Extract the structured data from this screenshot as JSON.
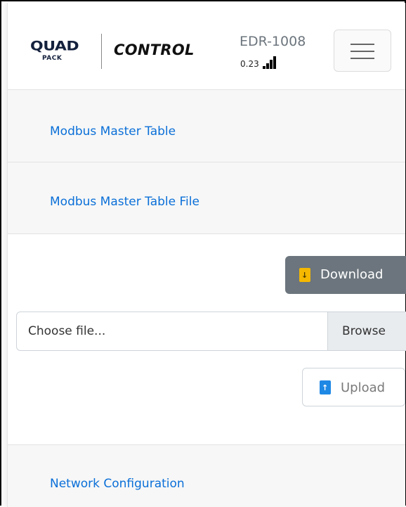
{
  "header": {
    "logo_quad": "QUAD",
    "logo_pack": "PACK",
    "logo_control": "CONTROL",
    "device_name": "EDR-1008",
    "device_version": "0.23",
    "signal_icon": "signal-strength-icon",
    "menu_icon": "hamburger-menu-icon"
  },
  "sections": {
    "modbus_master_table": "Modbus Master Table",
    "modbus_master_table_file": "Modbus Master Table File",
    "network_configuration": "Network Configuration"
  },
  "file_panel": {
    "download_label": "Download",
    "download_icon": "file-download-icon",
    "file_placeholder": "Choose file...",
    "browse_label": "Browse",
    "upload_label": "Upload",
    "upload_icon": "file-upload-icon"
  },
  "colors": {
    "link": "#0a6fd8",
    "download_bg": "#6c757d",
    "download_icon": "#f5b800",
    "upload_icon": "#1e88e5",
    "section_bg": "#f7f7f7"
  }
}
